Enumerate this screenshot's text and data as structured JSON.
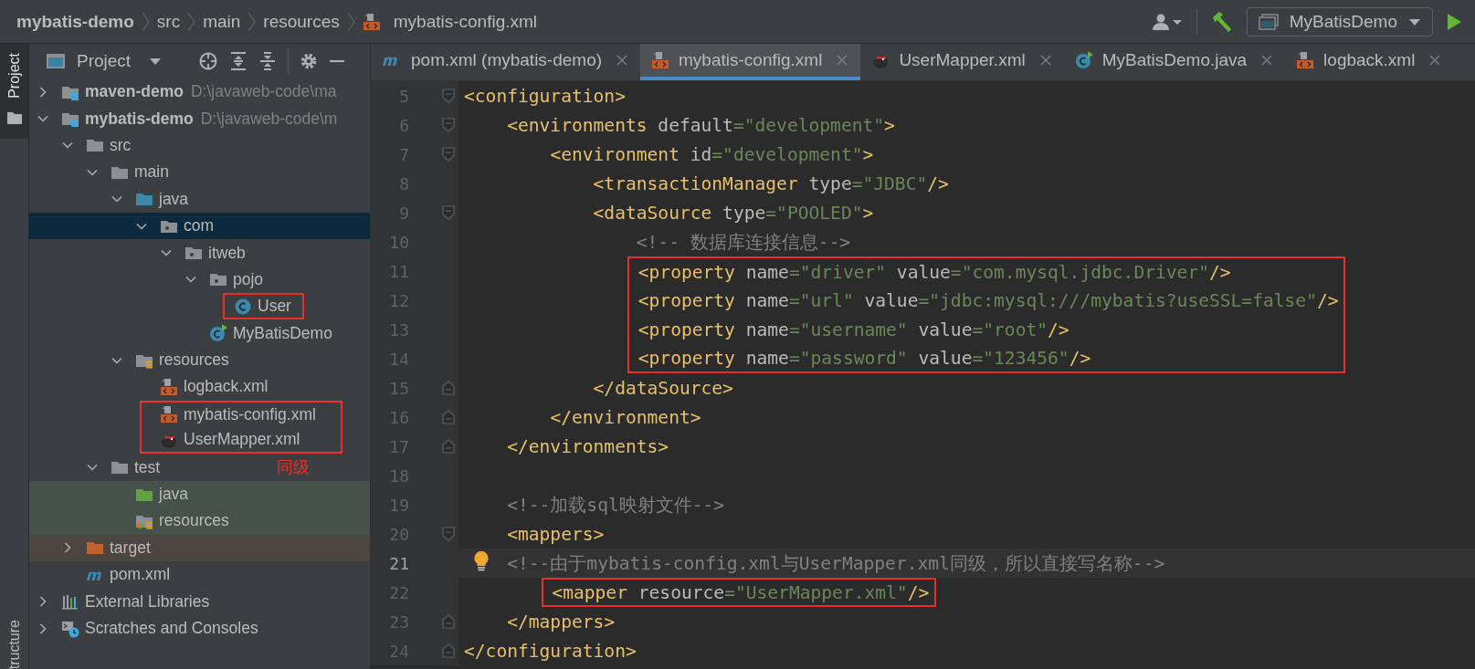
{
  "breadcrumbs": [
    {
      "label": "mybatis-demo",
      "kind": "project"
    },
    {
      "label": "src",
      "kind": "folder"
    },
    {
      "label": "main",
      "kind": "folder"
    },
    {
      "label": "resources",
      "kind": "folder"
    },
    {
      "label": "mybatis-config.xml",
      "kind": "xml"
    }
  ],
  "toolbar": {
    "run_configuration": "MyBatisDemo"
  },
  "side_tabs": [
    {
      "label": "Project",
      "selected": true
    },
    {
      "label": "tructure",
      "selected": false
    }
  ],
  "project_panel": {
    "title": "Project",
    "tree": [
      {
        "label": "maven-demo",
        "path": "D:\\javaweb-code\\ma",
        "kind": "module",
        "expanded": false,
        "selected": false,
        "boxed": false
      },
      {
        "label": "mybatis-demo",
        "path": "D:\\javaweb-code\\m",
        "kind": "module",
        "expanded": true,
        "selected": false,
        "boxed": false,
        "children": [
          {
            "label": "src",
            "kind": "folder",
            "expanded": true,
            "selected": false,
            "boxed": false,
            "children": [
              {
                "label": "main",
                "kind": "folder",
                "expanded": true,
                "selected": false,
                "boxed": false,
                "children": [
                  {
                    "label": "java",
                    "kind": "source-folder",
                    "expanded": true,
                    "selected": false,
                    "boxed": false,
                    "children": [
                      {
                        "label": "com",
                        "kind": "package",
                        "expanded": true,
                        "selected": true,
                        "boxed": false,
                        "children": [
                          {
                            "label": "itweb",
                            "kind": "package",
                            "expanded": true,
                            "selected": false,
                            "boxed": false,
                            "children": [
                              {
                                "label": "pojo",
                                "kind": "package",
                                "expanded": true,
                                "selected": false,
                                "boxed": false,
                                "children": [
                                  {
                                    "label": "User",
                                    "kind": "class",
                                    "selected": false,
                                    "boxed": true
                                  }
                                ]
                              },
                              {
                                "label": "MyBatisDemo",
                                "kind": "main-class",
                                "selected": false,
                                "boxed": false
                              }
                            ]
                          }
                        ]
                      }
                    ]
                  },
                  {
                    "label": "resources",
                    "kind": "resources-folder",
                    "expanded": true,
                    "selected": false,
                    "boxed": false,
                    "children": [
                      {
                        "label": "logback.xml",
                        "kind": "xml",
                        "selected": false,
                        "boxed": false
                      },
                      {
                        "label": "mybatis-config.xml",
                        "kind": "xml",
                        "selected": false,
                        "boxed": true
                      },
                      {
                        "label": "UserMapper.xml",
                        "kind": "mybatis",
                        "selected": false,
                        "boxed": true
                      }
                    ]
                  }
                ]
              },
              {
                "label": "test",
                "kind": "folder",
                "expanded": true,
                "selected": false,
                "boxed": false,
                "note": "同级",
                "children": [
                  {
                    "label": "java",
                    "kind": "test-folder",
                    "selected": false,
                    "boxed": false
                  },
                  {
                    "label": "resources",
                    "kind": "test-resources",
                    "selected": false,
                    "boxed": false
                  }
                ]
              }
            ]
          },
          {
            "label": "target",
            "kind": "excluded-folder",
            "expanded": false,
            "selected": false,
            "boxed": false
          },
          {
            "label": "pom.xml",
            "kind": "maven",
            "selected": false,
            "boxed": false
          }
        ]
      },
      {
        "label": "External Libraries",
        "kind": "libraries",
        "expanded": false,
        "selected": false,
        "boxed": false
      },
      {
        "label": "Scratches and Consoles",
        "kind": "scratches",
        "expanded": false,
        "selected": false,
        "boxed": false
      }
    ]
  },
  "editor_tabs": [
    {
      "label": "pom.xml (mybatis-demo)",
      "kind": "maven",
      "selected": false
    },
    {
      "label": "mybatis-config.xml",
      "kind": "xml",
      "selected": true
    },
    {
      "label": "UserMapper.xml",
      "kind": "mybatis",
      "selected": false
    },
    {
      "label": "MyBatisDemo.java",
      "kind": "main-class",
      "selected": false
    },
    {
      "label": "logback.xml",
      "kind": "xml",
      "selected": false
    }
  ],
  "editor": {
    "lines": [
      {
        "number": "5",
        "fold": {
          "kind": "start"
        },
        "current": false,
        "bulb": false,
        "boxed": false,
        "tokens": [
          {
            "kind": "tag",
            "t": "<configuration>"
          }
        ]
      },
      {
        "number": "6",
        "fold": {
          "kind": "start"
        },
        "current": false,
        "bulb": false,
        "boxed": false,
        "tokens": [
          {
            "kind": "tag",
            "t": "    <environments"
          },
          {
            "kind": "attr",
            "t": " default"
          },
          {
            "kind": "value",
            "t": "=\"development\""
          },
          {
            "kind": "tag",
            "t": ">"
          }
        ]
      },
      {
        "number": "7",
        "fold": {
          "kind": "start"
        },
        "current": false,
        "bulb": false,
        "boxed": false,
        "tokens": [
          {
            "kind": "tag",
            "t": "        <environment"
          },
          {
            "kind": "attr",
            "t": " id"
          },
          {
            "kind": "value",
            "t": "=\"development\""
          },
          {
            "kind": "tag",
            "t": ">"
          }
        ]
      },
      {
        "number": "8",
        "current": false,
        "bulb": false,
        "boxed": false,
        "tokens": [
          {
            "kind": "tag",
            "t": "            <transactionManager"
          },
          {
            "kind": "attr",
            "t": " type"
          },
          {
            "kind": "value",
            "t": "=\"JDBC\""
          },
          {
            "kind": "tag",
            "t": "/>"
          }
        ]
      },
      {
        "number": "9",
        "fold": {
          "kind": "start"
        },
        "current": false,
        "bulb": false,
        "boxed": false,
        "tokens": [
          {
            "kind": "tag",
            "t": "            <dataSource"
          },
          {
            "kind": "attr",
            "t": " type"
          },
          {
            "kind": "value",
            "t": "=\"POOLED\""
          },
          {
            "kind": "tag",
            "t": ">"
          }
        ]
      },
      {
        "number": "10",
        "current": false,
        "bulb": false,
        "boxed": false,
        "tokens": [
          {
            "kind": "comment",
            "t": "                <!-- 数据库连接信息-->"
          }
        ]
      },
      {
        "number": "11",
        "current": false,
        "bulb": false,
        "boxed": true,
        "tokens": [
          {
            "kind": "tag",
            "t": "                <property"
          },
          {
            "kind": "attr",
            "t": " name"
          },
          {
            "kind": "value",
            "t": "=\"driver\""
          },
          {
            "kind": "attr",
            "t": " value"
          },
          {
            "kind": "value",
            "t": "=\"com.mysql.jdbc.Driver\""
          },
          {
            "kind": "tag",
            "t": "/>"
          }
        ]
      },
      {
        "number": "12",
        "current": false,
        "bulb": false,
        "boxed": true,
        "tokens": [
          {
            "kind": "tag",
            "t": "                <property"
          },
          {
            "kind": "attr",
            "t": " name"
          },
          {
            "kind": "value",
            "t": "=\"url\""
          },
          {
            "kind": "attr",
            "t": " value"
          },
          {
            "kind": "value",
            "t": "=\"jdbc:mysql:///mybatis?useSSL=false\""
          },
          {
            "kind": "tag",
            "t": "/>"
          }
        ]
      },
      {
        "number": "13",
        "current": false,
        "bulb": false,
        "boxed": true,
        "tokens": [
          {
            "kind": "tag",
            "t": "                <property"
          },
          {
            "kind": "attr",
            "t": " name"
          },
          {
            "kind": "value",
            "t": "=\"username\""
          },
          {
            "kind": "attr",
            "t": " value"
          },
          {
            "kind": "value",
            "t": "=\"root\""
          },
          {
            "kind": "tag",
            "t": "/>"
          }
        ]
      },
      {
        "number": "14",
        "current": false,
        "bulb": false,
        "boxed": true,
        "tokens": [
          {
            "kind": "tag",
            "t": "                <property"
          },
          {
            "kind": "attr",
            "t": " name"
          },
          {
            "kind": "value",
            "t": "=\"password\""
          },
          {
            "kind": "attr",
            "t": " value"
          },
          {
            "kind": "value",
            "t": "=\"123456\""
          },
          {
            "kind": "tag",
            "t": "/>"
          }
        ]
      },
      {
        "number": "15",
        "fold": {
          "kind": "end"
        },
        "current": false,
        "bulb": false,
        "boxed": false,
        "tokens": [
          {
            "kind": "tag",
            "t": "            </dataSource>"
          }
        ]
      },
      {
        "number": "16",
        "fold": {
          "kind": "end"
        },
        "current": false,
        "bulb": false,
        "boxed": false,
        "tokens": [
          {
            "kind": "tag",
            "t": "        </environment>"
          }
        ]
      },
      {
        "number": "17",
        "fold": {
          "kind": "end"
        },
        "current": false,
        "bulb": false,
        "boxed": false,
        "tokens": [
          {
            "kind": "tag",
            "t": "    </environments>"
          }
        ]
      },
      {
        "number": "18",
        "current": false,
        "bulb": false
      },
      {
        "number": "19",
        "current": false,
        "bulb": false,
        "boxed": false,
        "tokens": [
          {
            "kind": "comment",
            "t": "    <!--加载sql映射文件-->"
          }
        ]
      },
      {
        "number": "20",
        "fold": {
          "kind": "start"
        },
        "current": false,
        "bulb": false,
        "boxed": false,
        "tokens": [
          {
            "kind": "tag",
            "t": "    <mappers>"
          }
        ]
      },
      {
        "number": "21",
        "current": true,
        "bulb": true,
        "boxed": false,
        "tokens": [
          {
            "kind": "comment",
            "t": "    <!--由于mybatis-config.xml与UserMapper.xml同级，所以直接写名称-->"
          }
        ]
      },
      {
        "number": "22",
        "current": false,
        "bulb": false,
        "boxed": true,
        "tokens": [
          {
            "kind": "tag",
            "t": "        <mapper"
          },
          {
            "kind": "attr",
            "t": " resource"
          },
          {
            "kind": "value",
            "t": "=\"UserMapper.xml\""
          },
          {
            "kind": "tag",
            "t": "/>"
          }
        ]
      },
      {
        "number": "23",
        "fold": {
          "kind": "end"
        },
        "current": false,
        "bulb": false,
        "boxed": false,
        "tokens": [
          {
            "kind": "tag",
            "t": "    </mappers>"
          }
        ]
      },
      {
        "number": "24",
        "fold": {
          "kind": "end"
        },
        "current": false,
        "bulb": false,
        "boxed": false,
        "tokens": [
          {
            "kind": "tag",
            "t": "</configuration>"
          }
        ]
      }
    ]
  }
}
